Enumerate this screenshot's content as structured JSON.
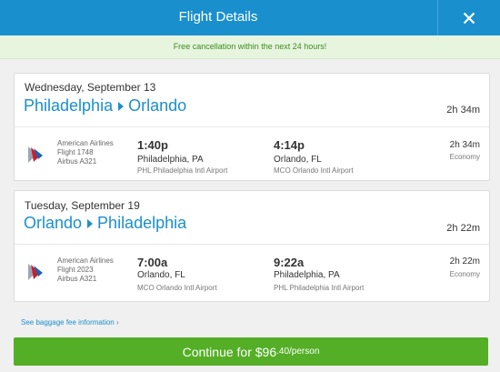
{
  "header": {
    "title": "Flight Details",
    "close_icon": "close-icon"
  },
  "banner": {
    "text": "Free cancellation within the next 24 hours!"
  },
  "trips": [
    {
      "date": "Wednesday, September 13",
      "origin": "Philadelphia",
      "destination": "Orlando",
      "duration": "2h 34m",
      "segment": {
        "airline": "American Airlines",
        "flight": "Flight 1748",
        "aircraft": "Airbus A321",
        "depart_time": "1:40p",
        "depart_city": "Philadelphia, PA",
        "depart_airport": "PHL Philadelphia Intl Airport",
        "arrive_time": "4:14p",
        "arrive_city": "Orlando, FL",
        "arrive_airport": "MCO Orlando Intl Airport",
        "duration": "2h 34m",
        "cabin": "Economy"
      }
    },
    {
      "date": "Tuesday, September 19",
      "origin": "Orlando",
      "destination": "Philadelphia",
      "duration": "2h 22m",
      "segment": {
        "airline": "American Airlines",
        "flight": "Flight 2023",
        "aircraft": "Airbus A321",
        "depart_time": "7:00a",
        "depart_city": "Orlando, FL",
        "depart_airport": "MCO Orlando Intl Airport",
        "arrive_time": "9:22a",
        "arrive_city": "Philadelphia, PA",
        "arrive_airport": "PHL Philadelphia Intl Airport",
        "duration": "2h 22m",
        "cabin": "Economy"
      }
    }
  ],
  "baggage_link": "See baggage fee information",
  "cta": {
    "prefix": "Continue for ",
    "price_main": "$96",
    "price_cents": ".40/person"
  },
  "colors": {
    "header": "#1a8fce",
    "banner_bg": "#e7f5df",
    "banner_text": "#3d8b1e",
    "link": "#1a8fce",
    "cta": "#54ae26"
  }
}
